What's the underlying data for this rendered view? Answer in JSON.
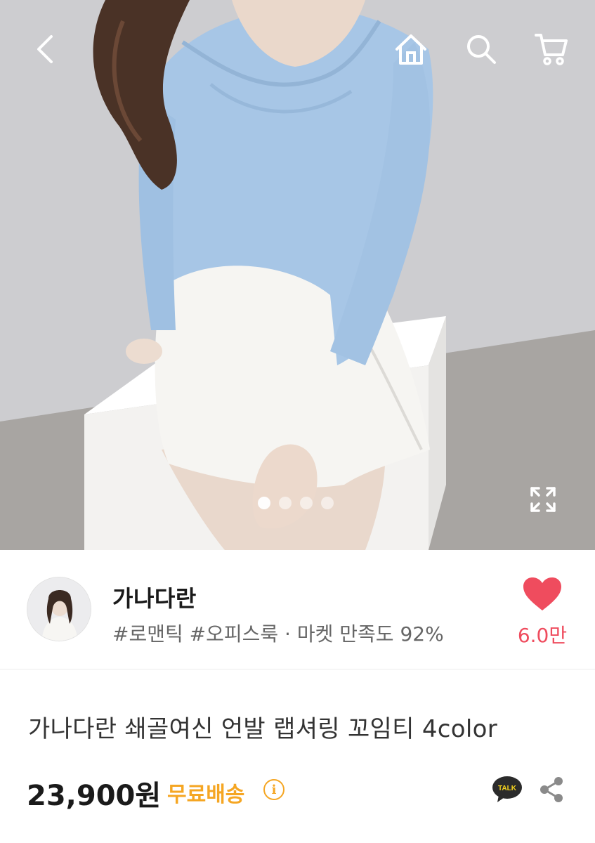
{
  "gallery": {
    "image_count": 4,
    "active_index": 0
  },
  "topbar": {
    "icons": [
      "back-icon",
      "home-icon",
      "search-icon",
      "cart-icon"
    ]
  },
  "shop": {
    "name": "가나다란",
    "meta": "#로맨틱 #오피스룩 · 마켓 만족도 92%",
    "like_count": "6.0만",
    "like_color": "#ef4c5e"
  },
  "product": {
    "title": "가나다란 쇄골여신 언발 랩셔링 꼬임티 4color",
    "price": "23,900원",
    "shipping": "무료배송",
    "shipping_color": "#f5a623",
    "info_glyph": "i",
    "talk_label": "TALK"
  }
}
